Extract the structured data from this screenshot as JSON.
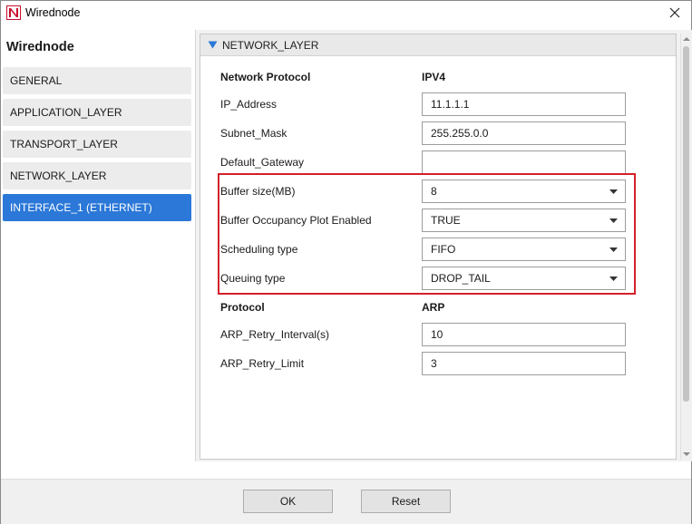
{
  "window": {
    "title": "Wirednode"
  },
  "sidebar": {
    "title": "Wirednode",
    "items": [
      {
        "label": "GENERAL",
        "active": false
      },
      {
        "label": "APPLICATION_LAYER",
        "active": false
      },
      {
        "label": "TRANSPORT_LAYER",
        "active": false
      },
      {
        "label": "NETWORK_LAYER",
        "active": false
      },
      {
        "label": "INTERFACE_1 (ETHERNET)",
        "active": true
      }
    ]
  },
  "section": {
    "title": "NETWORK_LAYER",
    "network_protocol": {
      "label": "Network Protocol",
      "value": "IPV4"
    },
    "fields": {
      "ip_address": {
        "label": "IP_Address",
        "value": "11.1.1.1"
      },
      "subnet_mask": {
        "label": "Subnet_Mask",
        "value": "255.255.0.0"
      },
      "default_gateway": {
        "label": "Default_Gateway",
        "value": ""
      },
      "buffer_size": {
        "label": "Buffer size(MB)",
        "value": "8"
      },
      "buffer_plot": {
        "label": "Buffer Occupancy Plot Enabled",
        "value": "TRUE"
      },
      "scheduling_type": {
        "label": "Scheduling type",
        "value": "FIFO"
      },
      "queuing_type": {
        "label": "Queuing type",
        "value": "DROP_TAIL"
      }
    },
    "protocol": {
      "label": "Protocol",
      "value": "ARP"
    },
    "arp_fields": {
      "retry_interval": {
        "label": "ARP_Retry_Interval(s)",
        "value": "10"
      },
      "retry_limit": {
        "label": "ARP_Retry_Limit",
        "value": "3"
      }
    }
  },
  "footer": {
    "ok_label": "OK",
    "reset_label": "Reset"
  },
  "colors": {
    "accent": "#2b78d8",
    "highlight": "#d4202a"
  },
  "icons": {
    "app": "netsim-logo-icon",
    "close": "close-icon",
    "collapse": "triangle-down-icon",
    "dropdown": "chevron-down-icon"
  }
}
